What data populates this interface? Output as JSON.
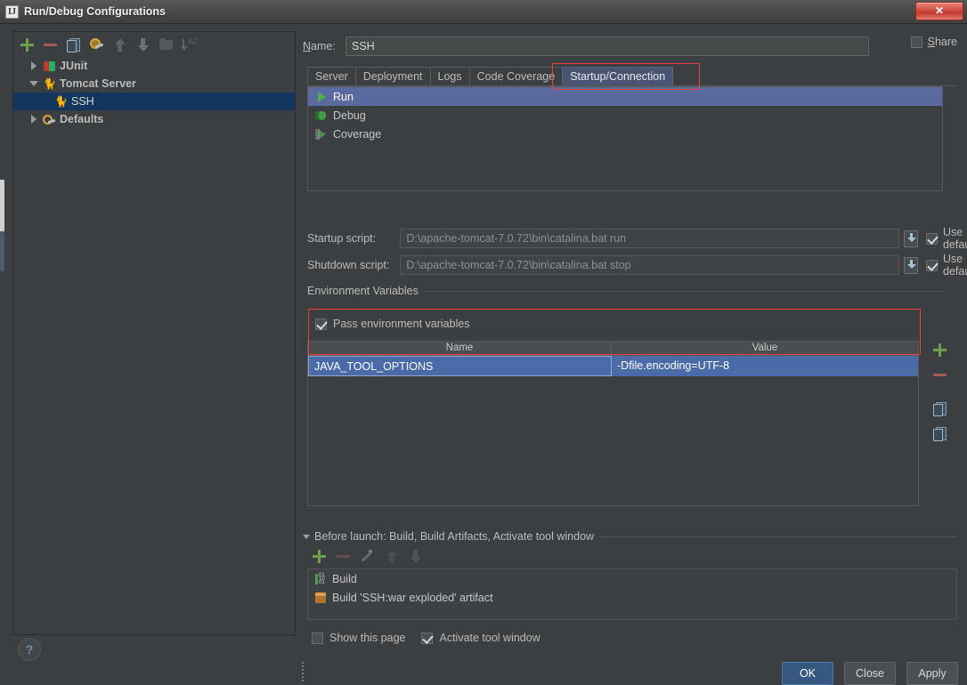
{
  "window": {
    "title": "Run/Debug Configurations",
    "app_icon": "IJ",
    "close_label": "✕"
  },
  "left_panel": {
    "toolbar": [
      {
        "name": "add-configuration-button",
        "icon": "plus-icon"
      },
      {
        "name": "remove-configuration-button",
        "icon": "minus-icon"
      },
      {
        "name": "copy-configuration-button",
        "icon": "copy-icon"
      },
      {
        "name": "edit-defaults-button",
        "icon": "wrench-icon"
      },
      {
        "name": "move-up-button",
        "icon": "arrow-up-icon"
      },
      {
        "name": "move-down-button",
        "icon": "arrow-down-icon"
      },
      {
        "name": "create-folder-button",
        "icon": "folder-icon"
      },
      {
        "name": "sort-configurations-button",
        "icon": "sort-az-icon"
      }
    ],
    "tree": [
      {
        "label": "JUnit",
        "icon": "junit-icon",
        "twisty": "right",
        "level": 1,
        "selected": false,
        "bold": true
      },
      {
        "label": "Tomcat Server",
        "icon": "tomcat-icon",
        "twisty": "down",
        "level": 1,
        "selected": false,
        "bold": true
      },
      {
        "label": "SSH",
        "icon": "tomcat-icon",
        "twisty": "none",
        "level": 2,
        "selected": true,
        "bold": false
      },
      {
        "label": "Defaults",
        "icon": "defaults-icon",
        "twisty": "right",
        "level": 1,
        "selected": false,
        "bold": true
      }
    ],
    "help_label": "?"
  },
  "form": {
    "name_label": "Name:",
    "name_value": "SSH",
    "name_placeholder": "",
    "share_label": "Share",
    "share_checked": false
  },
  "tabs": [
    {
      "label": "Server",
      "active": false
    },
    {
      "label": "Deployment",
      "active": false
    },
    {
      "label": "Logs",
      "active": false
    },
    {
      "label": "Code Coverage",
      "active": false
    },
    {
      "label": "Startup/Connection",
      "active": true
    }
  ],
  "run_modes": [
    {
      "label": "Run",
      "icon": "run-icon",
      "selected": true
    },
    {
      "label": "Debug",
      "icon": "debug-icon",
      "selected": false
    },
    {
      "label": "Coverage",
      "icon": "coverage-icon",
      "selected": false
    }
  ],
  "scripts": {
    "startup": {
      "label": "Startup script:",
      "value": "D:\\apache-tomcat-7.0.72\\bin\\catalina.bat run",
      "use_default_label": "Use default",
      "use_default_checked": true,
      "browse_icon": "insert-variable-icon"
    },
    "shutdown": {
      "label": "Shutdown script:",
      "value": "D:\\apache-tomcat-7.0.72\\bin\\catalina.bat stop",
      "use_default_label": "Use default",
      "use_default_checked": true,
      "browse_icon": "insert-variable-icon"
    }
  },
  "environment": {
    "group_title": "Environment Variables",
    "pass_env_label": "Pass environment variables",
    "pass_env_checked": true,
    "columns": [
      "Name",
      "Value"
    ],
    "rows": [
      {
        "name": "JAVA_TOOL_OPTIONS",
        "value": "-Dfile.encoding=UTF-8",
        "selected": true
      }
    ],
    "side_buttons": [
      {
        "name": "add-env-var-button",
        "icon": "plus-icon"
      },
      {
        "name": "remove-env-var-button",
        "icon": "minus-icon"
      },
      {
        "name": "copy-env-var-button",
        "icon": "copy-icon"
      },
      {
        "name": "paste-env-var-button",
        "icon": "paste-icon"
      }
    ]
  },
  "before_launch": {
    "header": "Before launch: Build, Build Artifacts, Activate tool window",
    "toolbar": [
      {
        "name": "add-task-button",
        "icon": "plus-icon",
        "enabled": true
      },
      {
        "name": "remove-task-button",
        "icon": "minus-icon",
        "enabled": false
      },
      {
        "name": "edit-task-button",
        "icon": "pencil-icon",
        "enabled": false
      },
      {
        "name": "move-task-up-button",
        "icon": "arrow-up-icon",
        "enabled": false
      },
      {
        "name": "move-task-down-button",
        "icon": "arrow-down-icon",
        "enabled": false
      }
    ],
    "tasks": [
      {
        "label": "Build",
        "icon": "build-icon"
      },
      {
        "label": "Build 'SSH:war exploded' artifact",
        "icon": "artifact-icon"
      }
    ],
    "show_page_label": "Show this page",
    "show_page_checked": false,
    "activate_tool_window_label": "Activate tool window",
    "activate_tool_window_checked": true
  },
  "dialog_buttons": [
    {
      "label": "OK",
      "primary": true,
      "mnemonic": ""
    },
    {
      "label": "Close",
      "primary": false,
      "mnemonic": "C"
    },
    {
      "label": "Apply",
      "primary": false,
      "mnemonic": "A"
    }
  ],
  "colors": {
    "panel_bg": "#3c3f41",
    "tree_selection": "#13365f",
    "list_selection": "#5a6a9e",
    "table_selection": "#4a6ba8",
    "active_tab": "#4a5573",
    "primary_button": "#365880",
    "annotation": "#ec3d3d",
    "accent_green": "#6ca04e"
  }
}
